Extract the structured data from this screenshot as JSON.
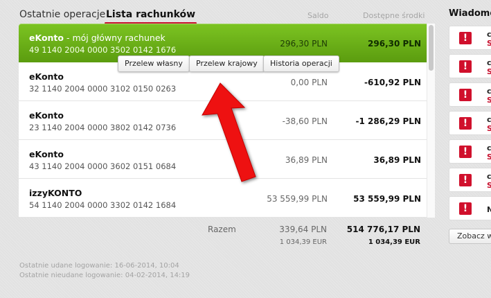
{
  "tabs": {
    "recent": "Ostatnie operacje",
    "accounts_list": "Lista rachunków"
  },
  "columns": {
    "saldo": "Saldo",
    "available": "Dostępne środki"
  },
  "accounts": [
    {
      "name": "eKonto",
      "subtitle": " - mój główny rachunek",
      "number": "49 1140 2004 0000 3502 0142 1676",
      "saldo": "296,30 PLN",
      "available": "296,30 PLN"
    },
    {
      "name": "eKonto",
      "subtitle": "",
      "number": "32 1140 2004 0000 3102 0150 0263",
      "saldo": "0,00 PLN",
      "available": "-610,92 PLN"
    },
    {
      "name": "eKonto",
      "subtitle": "",
      "number": "23 1140 2004 0000 3802 0142 0736",
      "saldo": "-38,60 PLN",
      "available": "-1 286,29 PLN"
    },
    {
      "name": "eKonto",
      "subtitle": "",
      "number": "43 1140 2004 0000 3602 0151 0684",
      "saldo": "36,89 PLN",
      "available": "36,89 PLN"
    },
    {
      "name": "izzyKONTO",
      "subtitle": "",
      "number": "54 1140 2004 0000 3302 0142 1684",
      "saldo": "53 559,99 PLN",
      "available": "53 559,99 PLN"
    }
  ],
  "actions": {
    "own_transfer": "Przelew własny",
    "domestic_transfer": "Przelew krajowy",
    "history": "Historia operacji"
  },
  "summary": {
    "label": "Razem",
    "saldo_pln": "339,64 PLN",
    "available_pln": "514 776,17 PLN",
    "saldo_eur": "1 034,39 EUR",
    "available_eur": "1 034,39 EUR"
  },
  "login": {
    "last_success": "Ostatnie udane logowanie: 16-06-2014, 10:04",
    "last_failed": "Ostatnie nieudane logowanie: 04-02-2014, 14:19"
  },
  "messages": {
    "title": "Wiadomo",
    "items": [
      {
        "icon": "alert-icon",
        "initial": "c",
        "sub": "S"
      },
      {
        "icon": "alert-icon",
        "initial": "c",
        "sub": "S"
      },
      {
        "icon": "alert-icon",
        "initial": "c",
        "sub": "S"
      },
      {
        "icon": "alert-icon",
        "initial": "c",
        "sub": "S"
      },
      {
        "icon": "alert-icon",
        "initial": "c",
        "sub": "S"
      },
      {
        "icon": "alert-icon",
        "initial": "c",
        "sub": "S"
      },
      {
        "icon": "alert-icon",
        "initial": "N",
        "sub": ""
      }
    ],
    "see_all": "Zobacz ws"
  },
  "colors": {
    "brand_red": "#c8102e",
    "active_row_green": "#6ab21a",
    "annotation_arrow": "#ee1111"
  }
}
